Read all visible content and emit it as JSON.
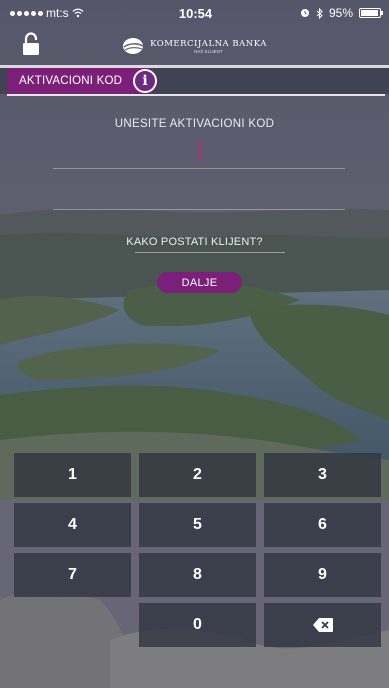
{
  "status_bar": {
    "carrier": "mt:s",
    "time": "10:54",
    "battery_text": "95%",
    "battery_level": 0.95
  },
  "header": {
    "lock_icon": "lock-icon",
    "logo_name": "KOMERCIJALNA BANKA",
    "logo_subtitle": "NAŠ KLIJENT"
  },
  "tab": {
    "label": "AKTIVACIONI KOD",
    "info_glyph": "i",
    "active_color": "#7b1f78"
  },
  "form": {
    "title": "UNESITE AKTIVACIONI KOD",
    "code_value": "",
    "link_text": "KAKO POSTATI KLIJENT?",
    "submit_label": "DALJE"
  },
  "keypad": {
    "keys": [
      "1",
      "2",
      "3",
      "4",
      "5",
      "6",
      "7",
      "8",
      "9",
      "0"
    ],
    "backspace_icon": "backspace-icon"
  }
}
